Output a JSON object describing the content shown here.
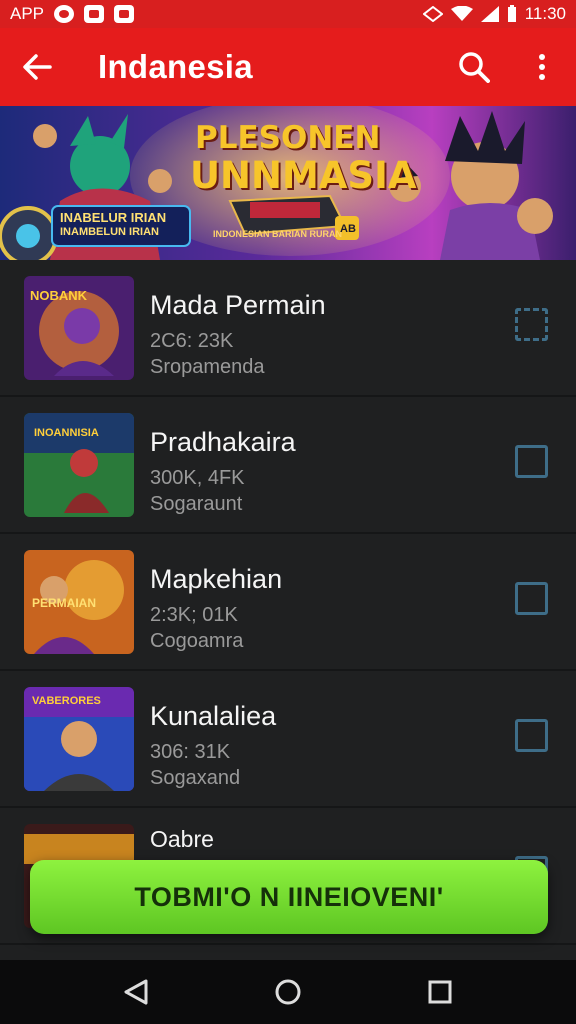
{
  "status_bar": {
    "carrier": "APP",
    "time": "11:30",
    "icons": [
      "app-badge-icon",
      "app-badge-icon",
      "app-badge-icon",
      "wifi-icon",
      "signal-icon",
      "battery-icon"
    ]
  },
  "appbar": {
    "title": "Indanesia",
    "icons": {
      "back": "arrow-left-icon",
      "search": "search-icon",
      "menu": "more-vert-icon"
    }
  },
  "banner": {
    "headline_1": "PLESONEN",
    "headline_2": "UNNMASIA",
    "left_caption_1": "INABELUR IRIAN",
    "left_caption_2": "INAMBELUN IRIAN",
    "small_caption": "INDONESIAN BARIAN RURAN",
    "badge": "AB",
    "colors": {
      "bg_left": "#2a1d6b",
      "bg_right": "#c23bc8",
      "headline": "#f7c52a"
    }
  },
  "list": [
    {
      "title": "Mada Permain",
      "stats": "2C6: 23K",
      "subtitle": "Sropamenda",
      "thumb_caption": "NOBANK",
      "checked_style": "dashed"
    },
    {
      "title": "Pradhakaira",
      "stats": "300K, 4FK",
      "subtitle": "Sogaraunt",
      "thumb_caption": "INOANNISIA",
      "checked_style": "solid"
    },
    {
      "title": "Mapkehian",
      "stats": "2:3K; 01K",
      "subtitle": "Cogoamra",
      "thumb_caption": "PERMAIAN",
      "checked_style": "solid"
    },
    {
      "title": "Kunalaliea",
      "stats": "306: 31K",
      "subtitle": "Sogaxand",
      "thumb_caption": "VABERORES",
      "checked_style": "solid"
    },
    {
      "title": "Oabre",
      "stats": "",
      "subtitle": "",
      "thumb_caption": "",
      "checked_style": "solid"
    }
  ],
  "fab": {
    "label": "TOBMI'O N IINEIOVENI'"
  },
  "navbar": {
    "icons": [
      "back-triangle-icon",
      "home-circle-icon",
      "recents-square-icon"
    ]
  },
  "colors": {
    "accent_red": "#e51c1c",
    "button_green": "#6fd62b",
    "checkbox_border": "#3e6d88"
  }
}
